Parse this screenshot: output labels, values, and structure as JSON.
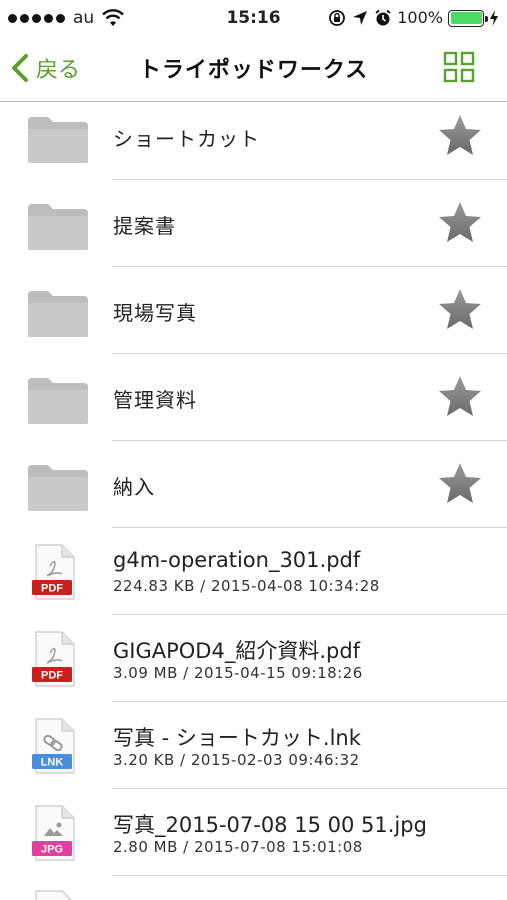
{
  "status_bar": {
    "carrier": "au",
    "time": "15:16",
    "battery_percent": "100%",
    "battery_level": 1.0,
    "icons": [
      "signal-dots",
      "wifi-icon",
      "rotation-lock-icon",
      "location-arrow-icon",
      "alarm-icon",
      "battery-icon",
      "charging-bolt-icon"
    ]
  },
  "nav": {
    "back_label": "戻る",
    "title": "トライポッドワークス",
    "grid_icon": "grid-view-icon",
    "accent": "#5aa02c"
  },
  "folders": [
    {
      "name": "ショートカット",
      "icon": "folder-icon",
      "star": "star-icon"
    },
    {
      "name": "提案書",
      "icon": "folder-icon",
      "star": "star-icon"
    },
    {
      "name": "現場写真",
      "icon": "folder-icon",
      "star": "star-icon"
    },
    {
      "name": "管理資料",
      "icon": "folder-icon",
      "star": "star-icon"
    },
    {
      "name": "納入",
      "icon": "folder-icon",
      "star": "star-icon"
    }
  ],
  "files": [
    {
      "name": "g4m-operation_301.pdf",
      "meta": "224.83 KB / 2015-04-08 10:34:28",
      "badge": "PDF",
      "badge_color": "#c8201e",
      "icon": "pdf-file-icon"
    },
    {
      "name": "GIGAPOD4_紹介資料.pdf",
      "meta": "3.09 MB / 2015-04-15 09:18:26",
      "badge": "PDF",
      "badge_color": "#c8201e",
      "icon": "pdf-file-icon"
    },
    {
      "name": "写真 - ショートカット.lnk",
      "meta": "3.20 KB / 2015-02-03 09:46:32",
      "badge": "LNK",
      "badge_color": "#4a8fdc",
      "icon": "link-file-icon"
    },
    {
      "name": "写真_2015-07-08 15 00 51.jpg",
      "meta": "2.80 MB / 2015-07-08 15:01:08",
      "badge": "JPG",
      "badge_color": "#e040a0",
      "icon": "image-file-icon"
    }
  ]
}
